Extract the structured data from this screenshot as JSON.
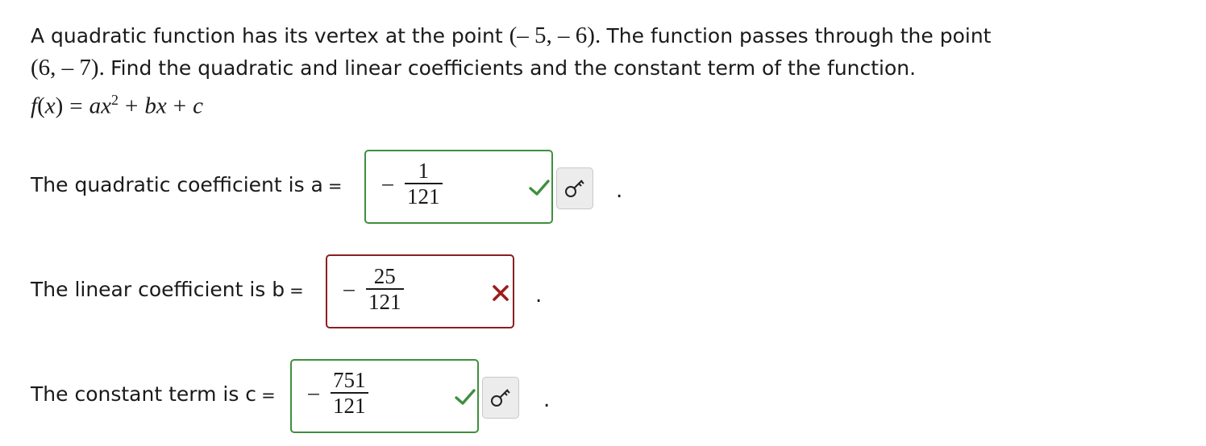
{
  "problem": {
    "line1_text": "A quadratic function has its vertex at the point",
    "vertex_open": "(",
    "vertex_x": "– 5,",
    "vertex_y": "– 6",
    "vertex_close": ").",
    "line1_tail": "The function passes through the point",
    "point_open": "(6,",
    "point_y": "– 7",
    "point_close": ").",
    "line2_text": "Find the quadratic and linear coefficients and the constant term of the function.",
    "formula": {
      "f": "f",
      "lparen": "(",
      "x": "x",
      "rparen": ")",
      "eq": "=",
      "a": "a",
      "x2": "x",
      "sup": "2",
      "plus1": "+",
      "b": "b",
      "x3": "x",
      "plus2": "+",
      "c": "c"
    }
  },
  "answers": [
    {
      "label": "The quadratic coefficient is a",
      "eq": "=",
      "sign": "–",
      "numerator": "1",
      "denominator": "121",
      "status": "correct",
      "status_icon": "checkmark-icon",
      "period": "."
    },
    {
      "label": "The linear coefficient is b",
      "eq": "=",
      "sign": "–",
      "numerator": "25",
      "denominator": "121",
      "status": "incorrect",
      "status_icon": "x-mark-icon",
      "period": "."
    },
    {
      "label": "The constant term is c",
      "eq": "=",
      "sign": "–",
      "numerator": "751",
      "denominator": "121",
      "status": "correct",
      "status_icon": "checkmark-icon",
      "period": "."
    }
  ],
  "colors": {
    "correct_border": "#3f8f3f",
    "incorrect_border": "#8a1f1f",
    "check": "#3f8f3f",
    "x_mark": "#9b1c1c",
    "key_button_bg": "#ececec"
  },
  "icons": {
    "key": "key-icon"
  }
}
